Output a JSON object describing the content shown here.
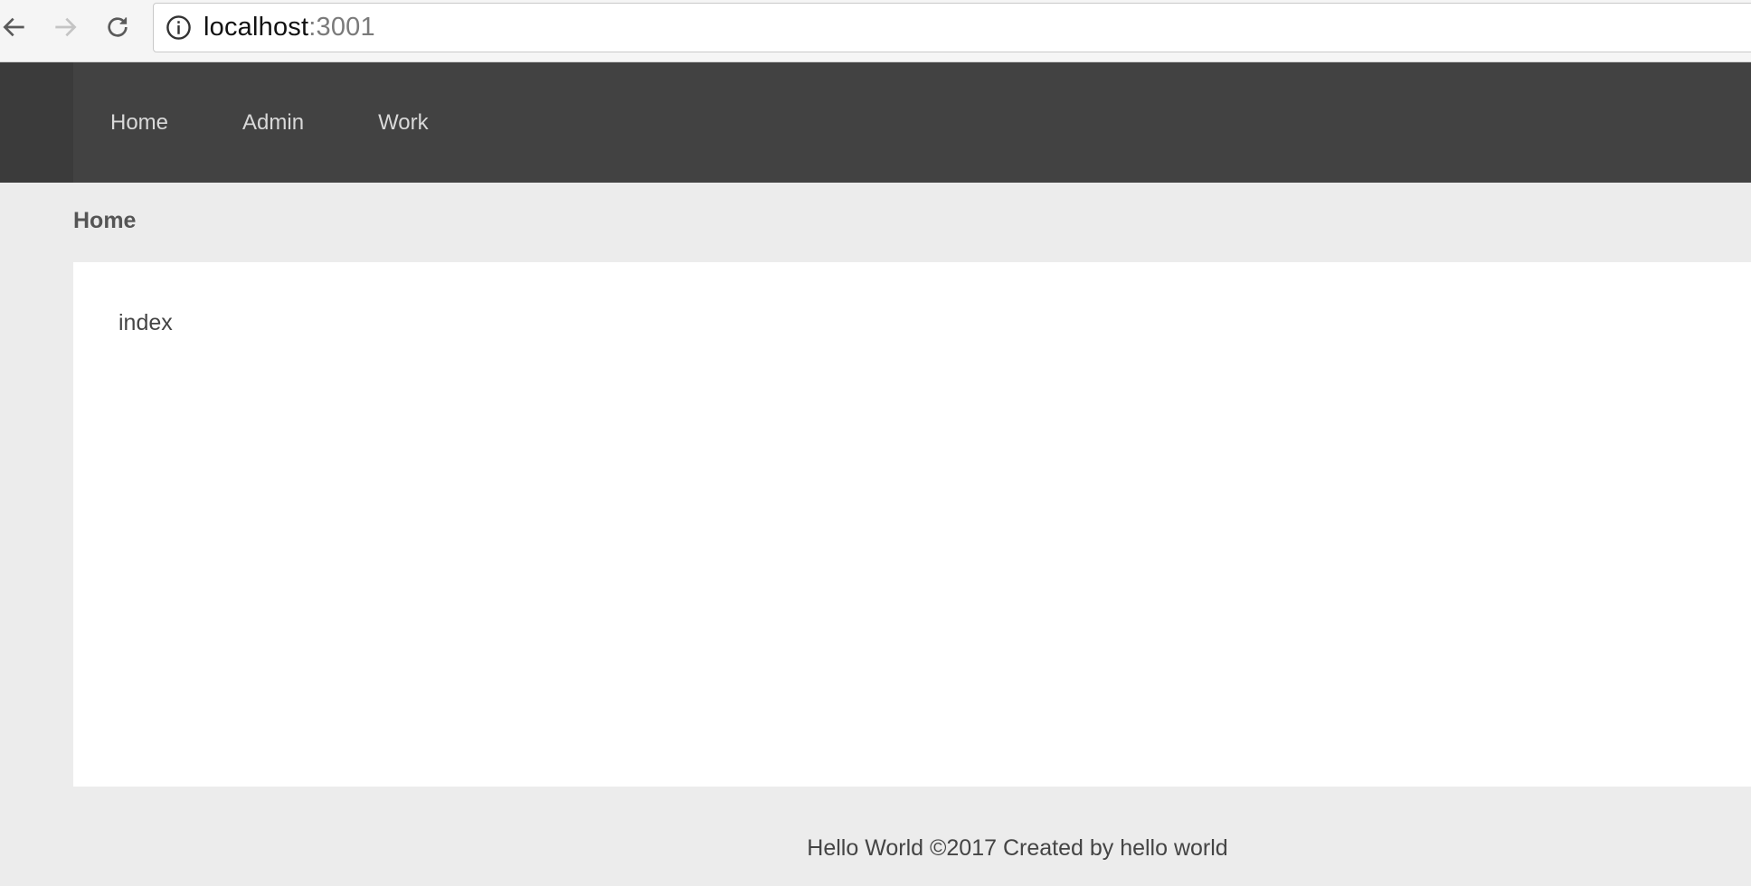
{
  "browser": {
    "url_host": "localhost",
    "url_port": ":3001",
    "back_icon": "arrow-left-icon",
    "forward_icon": "arrow-right-icon",
    "reload_icon": "reload-icon",
    "info_icon": "info-circle-icon"
  },
  "header": {
    "nav": [
      {
        "label": "Home"
      },
      {
        "label": "Admin"
      },
      {
        "label": "Work"
      }
    ],
    "background_color": "#424242"
  },
  "breadcrumb": {
    "current": "Home"
  },
  "main": {
    "content_text": "index"
  },
  "footer": {
    "text": "Hello World ©2017 Created by hello world"
  },
  "colors": {
    "page_background": "#ececec",
    "card_background": "#ffffff",
    "nav_text": "#d9d9d9"
  }
}
